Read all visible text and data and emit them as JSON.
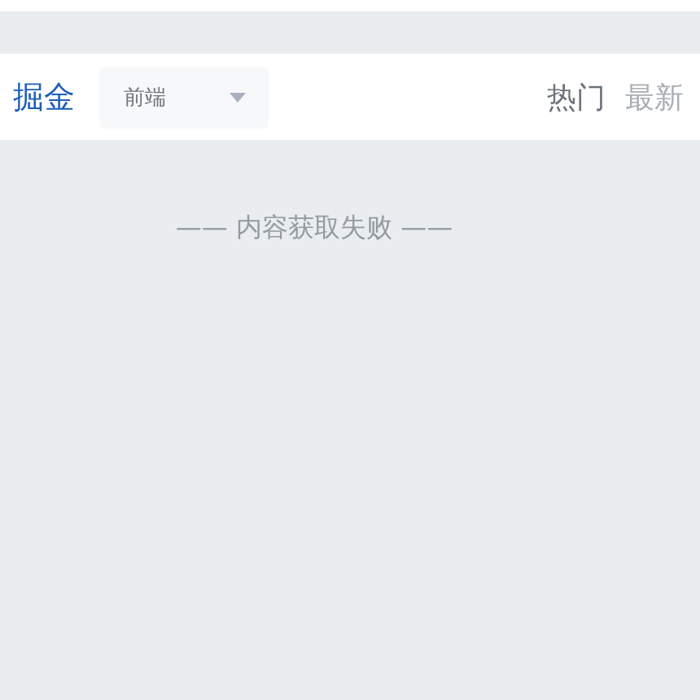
{
  "header": {
    "logo": "掘金",
    "category_select": {
      "value": "前端"
    },
    "tabs": [
      {
        "label": "热门",
        "selected": true
      },
      {
        "label": "最新",
        "selected": false
      }
    ]
  },
  "message": "—— 内容获取失败 ——"
}
